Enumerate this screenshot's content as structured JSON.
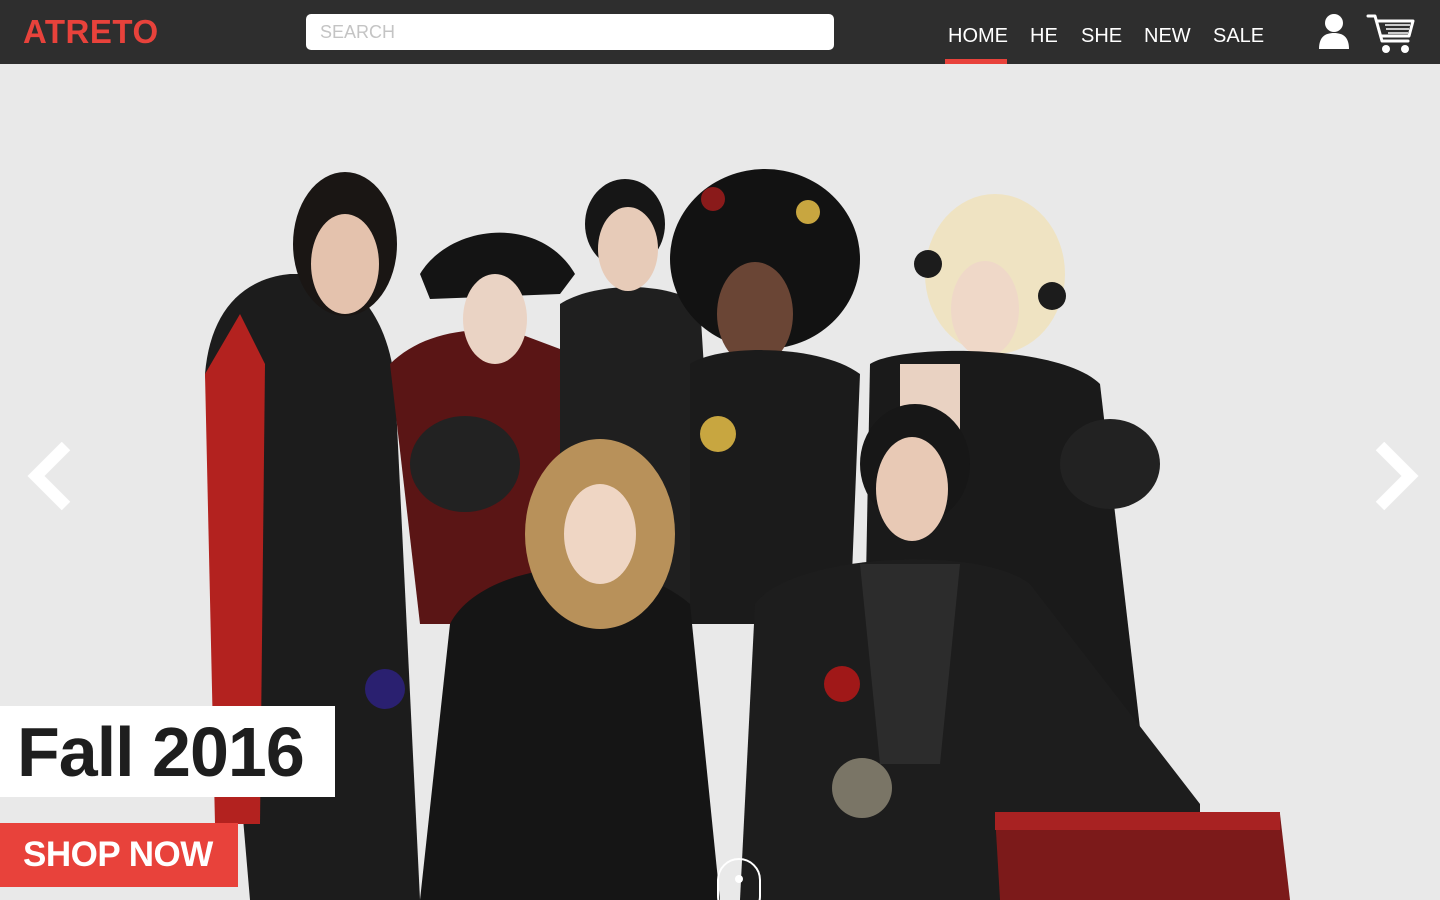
{
  "brand": {
    "name": "ATRETO",
    "accent_color": "#e8423b",
    "header_bg": "#2e2e2e"
  },
  "search": {
    "placeholder": "SEARCH",
    "value": ""
  },
  "nav": {
    "items": [
      {
        "label": "HOME",
        "active": true
      },
      {
        "label": "HE",
        "active": false
      },
      {
        "label": "SHE",
        "active": false
      },
      {
        "label": "NEW",
        "active": false
      },
      {
        "label": "SALE",
        "active": false
      }
    ]
  },
  "header_icons": {
    "account": "user-icon",
    "cart": "shopping-cart-icon"
  },
  "hero": {
    "caption": "Fall 2016",
    "cta_label": "SHOP NOW",
    "prev_icon": "chevron-left-icon",
    "next_icon": "chevron-right-icon",
    "scroll_indicator": "scroll-down-indicator"
  }
}
